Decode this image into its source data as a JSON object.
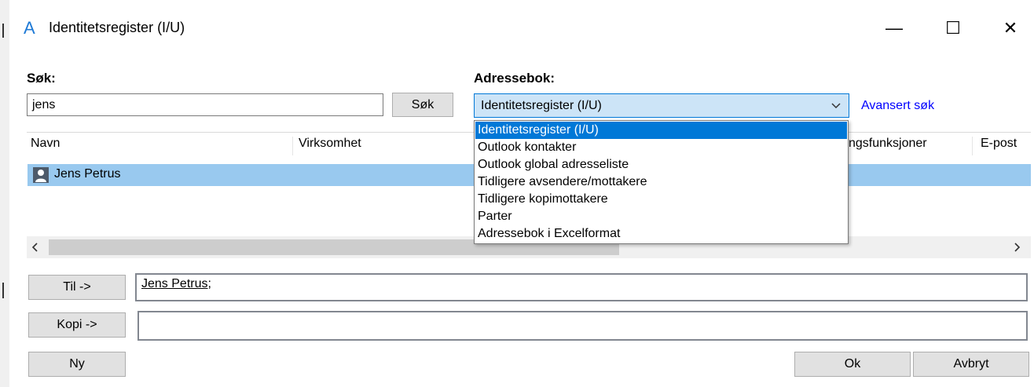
{
  "window": {
    "title": "Identitetsregister (I/U)",
    "app_icon_glyph": "A",
    "minimize_glyph": "—",
    "maximize_glyph": "☐",
    "close_glyph": "✕"
  },
  "search": {
    "label": "Søk:",
    "value": "jens",
    "button_label": "Søk"
  },
  "addressbook": {
    "label": "Adressebok:",
    "selected": "Identitetsregister (I/U)",
    "advanced_link": "Avansert søk",
    "options": [
      "Identitetsregister (I/U)",
      "Outlook kontakter",
      "Outlook global adresseliste",
      "Tidligere avsendere/mottakere",
      "Tidligere kopimottakere",
      "Parter",
      "Adressebok i Excelformat"
    ]
  },
  "table": {
    "columns": [
      "Navn",
      "Virksomhet",
      "ngsfunksjoner",
      "E-post"
    ],
    "rows": [
      {
        "navn": "Jens Petrus"
      }
    ]
  },
  "recipients": {
    "to_label": "Til ->",
    "to_value": "Jens Petrus;",
    "cc_label": "Kopi ->",
    "cc_value": ""
  },
  "footer": {
    "new_label": "Ny",
    "ok_label": "Ok",
    "cancel_label": "Avbryt"
  },
  "colors": {
    "accent": "#0078d7",
    "selection": "#99c9ef",
    "link": "#0000ff"
  }
}
